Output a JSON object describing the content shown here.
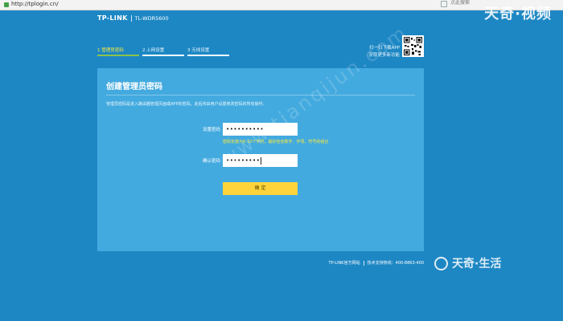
{
  "browser": {
    "url": "http://tplogin.cn/",
    "search_hint": "点此搜索"
  },
  "header": {
    "brand": "TP-LINK",
    "model": "TL-WDR5600"
  },
  "steps": [
    {
      "label": "1 管理员密码",
      "active": true
    },
    {
      "label": "2 上网设置",
      "active": false
    },
    {
      "label": "3 无线设置",
      "active": false
    }
  ],
  "app_hint": {
    "line1": "扫一扫下载APP",
    "line2": "获取更多新功能"
  },
  "panel": {
    "title": "创建管理员密码",
    "description": "管理员密码是进入路由器管理页面或APP的密码，此后将由用户设置修改密码的所有操作。",
    "password_label": "设置密码",
    "password_value": "••••••••••",
    "password_hint": "密码长度为6-32个字符，最好包含数字、字母、符号的组合",
    "confirm_label": "确认密码",
    "confirm_value": "•••••••••",
    "confirm_button": "确 定"
  },
  "footer": {
    "official_site": "TP-LINK官方网站",
    "support": "技术支持热线：400-8863-400"
  },
  "watermark": {
    "top": "天奇·视频",
    "diagonal": "www.tianqijun.com",
    "bottom": "天奇·生活"
  }
}
